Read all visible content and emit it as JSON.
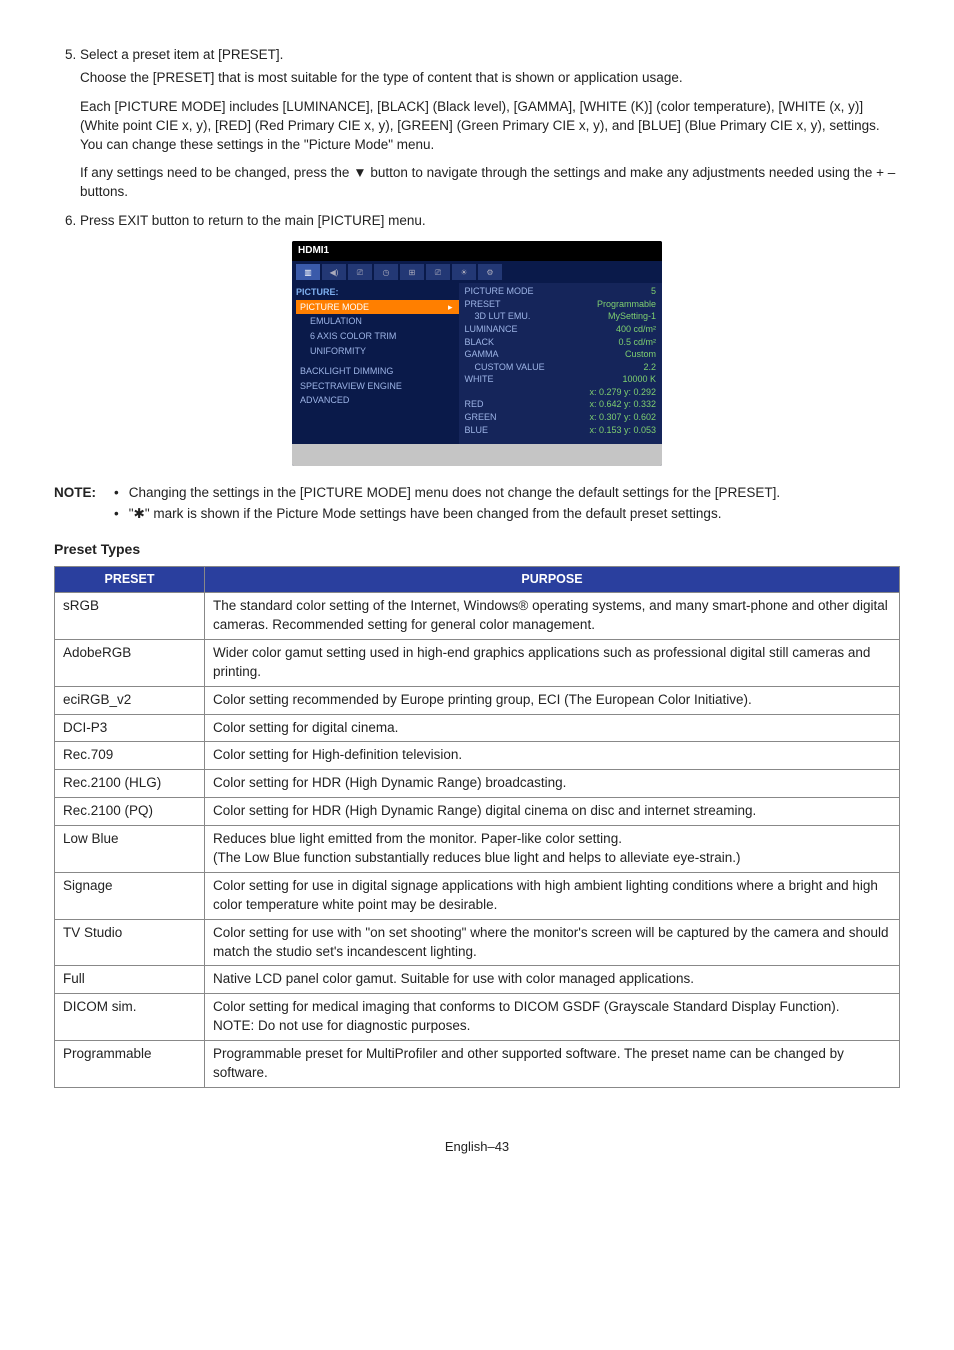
{
  "steps": {
    "s5": {
      "num": "5.",
      "title": "Select a preset item at [PRESET].",
      "p1": "Choose the [PRESET] that is most suitable for the type of content that is shown or application usage.",
      "p2": "Each [PICTURE MODE] includes [LUMINANCE], [BLACK] (Black level), [GAMMA], [WHITE (K)] (color temperature), [WHITE (x, y)] (White point CIE x, y), [RED] (Red Primary CIE x, y), [GREEN] (Green Primary CIE x, y), and [BLUE] (Blue Primary CIE x, y), settings. You can change these settings in the \"Picture Mode\" menu.",
      "p3a": "If any settings need to be changed, press the ",
      "p3b": " button to navigate through the settings and make any adjustments needed using the + – buttons."
    },
    "s6": {
      "num": "6.",
      "title": "Press EXIT button to return to the main [PICTURE] menu."
    }
  },
  "osd": {
    "title": "HDMI1",
    "section": "PICTURE:",
    "left": [
      {
        "label": "PICTURE MODE",
        "sel": true,
        "arrow": "▸"
      },
      {
        "label": "EMULATION",
        "indent": true
      },
      {
        "label": "6 AXIS COLOR TRIM",
        "indent": true
      },
      {
        "label": "UNIFORMITY",
        "indent": true
      },
      {
        "label": "BACKLIGHT DIMMING"
      },
      {
        "label": "SPECTRAVIEW ENGINE"
      },
      {
        "label": "ADVANCED"
      }
    ],
    "right": [
      {
        "label": "PICTURE MODE",
        "val": "5"
      },
      {
        "label": "PRESET",
        "val": "Programmable"
      },
      {
        "label": "3D LUT EMU.",
        "val": "MySetting-1",
        "indent": true
      },
      {
        "label": "LUMINANCE",
        "val": "400 cd/m²"
      },
      {
        "label": "BLACK",
        "val": "0.5 cd/m²"
      },
      {
        "label": "GAMMA",
        "val": "Custom"
      },
      {
        "label": "CUSTOM VALUE",
        "val": "2.2",
        "indent": true
      },
      {
        "label": "WHITE",
        "val": "10000 K"
      },
      {
        "label": "",
        "val": "x: 0.279    y: 0.292"
      },
      {
        "label": "RED",
        "val": "x: 0.642    y: 0.332"
      },
      {
        "label": "GREEN",
        "val": "x: 0.307    y: 0.602"
      },
      {
        "label": "BLUE",
        "val": "x: 0.153    y: 0.053"
      }
    ]
  },
  "note": {
    "label": "NOTE:",
    "b1": "Changing the settings in the [PICTURE MODE] menu does not change the default settings for the [PRESET].",
    "b2": "\"✱\" mark is shown if the Picture Mode settings have been changed from the default preset settings."
  },
  "presetHeading": "Preset Types",
  "table": {
    "h1": "PRESET",
    "h2": "PURPOSE",
    "rows": [
      {
        "p": "sRGB",
        "d": "The standard color setting of the Internet, Windows® operating systems, and many smart-phone and other digital cameras. Recommended setting for general color management."
      },
      {
        "p": "AdobeRGB",
        "d": "Wider color gamut setting used in high-end graphics applications such as professional digital still cameras and printing."
      },
      {
        "p": "eciRGB_v2",
        "d": "Color setting recommended by Europe printing group, ECI (The European Color Initiative)."
      },
      {
        "p": "DCI-P3",
        "d": "Color setting for digital cinema."
      },
      {
        "p": "Rec.709",
        "d": "Color setting for High-definition television."
      },
      {
        "p": "Rec.2100 (HLG)",
        "d": "Color setting for HDR (High Dynamic Range) broadcasting."
      },
      {
        "p": "Rec.2100 (PQ)",
        "d": "Color setting for HDR (High Dynamic Range) digital cinema on disc and internet streaming."
      },
      {
        "p": "Low Blue",
        "d": "Reduces blue light emitted from the monitor. Paper-like color setting.\n(The Low Blue function substantially reduces blue light and helps to alleviate eye-strain.)"
      },
      {
        "p": "Signage",
        "d": "Color setting for use in digital signage applications with high ambient lighting conditions where a bright and high color temperature white point may be desirable."
      },
      {
        "p": "TV Studio",
        "d": "Color setting for use with \"on set shooting\" where the monitor's screen will be captured by the camera and should match the studio set's incandescent lighting."
      },
      {
        "p": "Full",
        "d": "Native LCD panel color gamut. Suitable for use with color managed applications."
      },
      {
        "p": "DICOM sim.",
        "d": "Color setting for medical imaging that conforms to DICOM GSDF (Grayscale Standard Display Function).\nNOTE: Do not use for diagnostic purposes."
      },
      {
        "p": "Programmable",
        "d": "Programmable preset for MultiProfiler and other supported software. The preset name can be changed by software."
      }
    ]
  },
  "footer": "English–43",
  "glyphs": {
    "downTriangle": "▼"
  }
}
